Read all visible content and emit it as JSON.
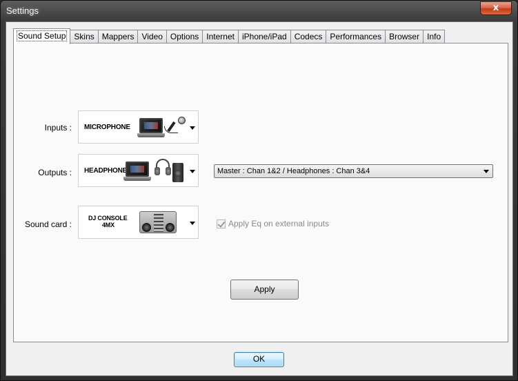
{
  "window": {
    "title": "Settings",
    "close_glyph": "x"
  },
  "tabs": [
    {
      "label": "Sound Setup",
      "active": true
    },
    {
      "label": "Skins"
    },
    {
      "label": "Mappers"
    },
    {
      "label": "Video"
    },
    {
      "label": "Options"
    },
    {
      "label": "Internet"
    },
    {
      "label": "iPhone/iPad"
    },
    {
      "label": "Codecs"
    },
    {
      "label": "Performances"
    },
    {
      "label": "Browser"
    },
    {
      "label": "Info"
    }
  ],
  "sound_setup": {
    "inputs": {
      "label": "Inputs :",
      "device": "MICROPHONE"
    },
    "outputs": {
      "label": "Outputs :",
      "device": "HEADPHONES",
      "routing": "Master : Chan 1&2 / Headphones : Chan 3&4"
    },
    "sound_card": {
      "label": "Sound card :",
      "device_line1": "DJ CONSOLE",
      "device_line2": "4MX"
    },
    "apply_eq": {
      "label": "Apply Eq on external inputs",
      "checked": true,
      "disabled": true
    },
    "apply_label": "Apply"
  },
  "footer": {
    "ok_label": "OK"
  },
  "colors": {
    "title_bar": "#3a3a3a",
    "close_button": "#c43b1a",
    "ok_focus_border": "#3c7fb1"
  }
}
